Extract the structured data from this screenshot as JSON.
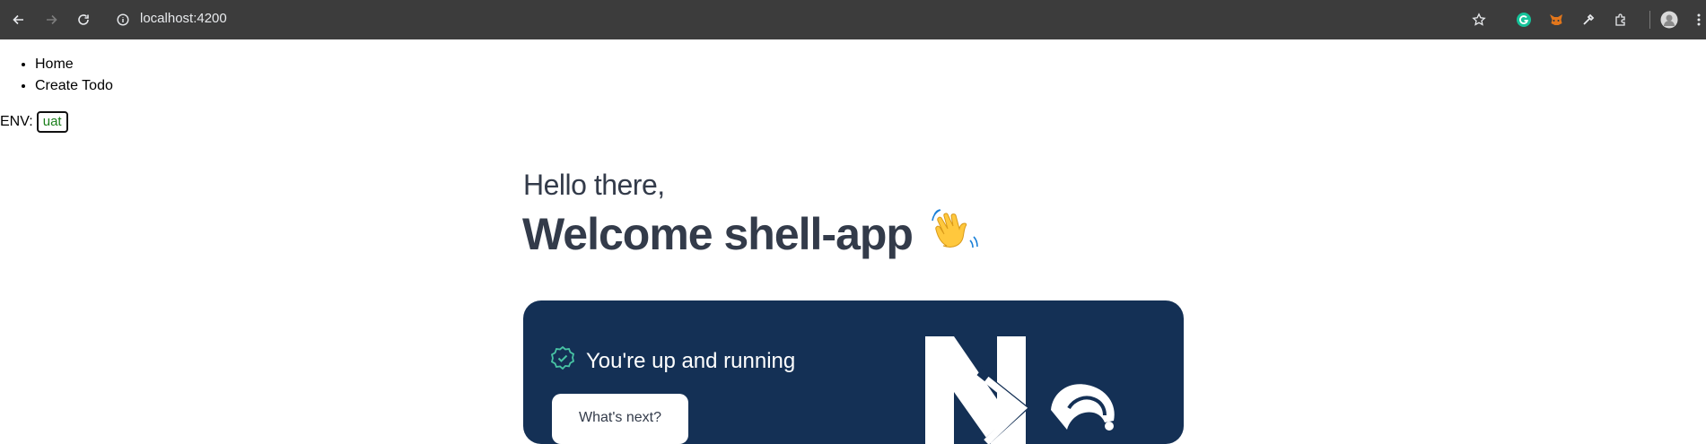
{
  "browser": {
    "url": "localhost:4200",
    "icons": [
      "back-icon",
      "forward-icon",
      "reload-icon",
      "site-info-icon",
      "star-icon",
      "grammarly-icon",
      "metamask-icon",
      "eyedropper-icon",
      "extensions-icon",
      "profile-avatar",
      "menu-icon"
    ]
  },
  "nav": {
    "items": [
      {
        "label": "Home"
      },
      {
        "label": "Create Todo"
      }
    ]
  },
  "env": {
    "label": "ENV:",
    "value": "uat"
  },
  "welcome": {
    "greeting": "Hello there,",
    "title": "Welcome shell-app"
  },
  "hero": {
    "status": "You're up and running",
    "next_button": "What's next?"
  },
  "colors": {
    "hero_bg": "#143055",
    "check": "#48c4a4",
    "text_dark": "#333b4a",
    "env_value": "#1a7f1a"
  }
}
